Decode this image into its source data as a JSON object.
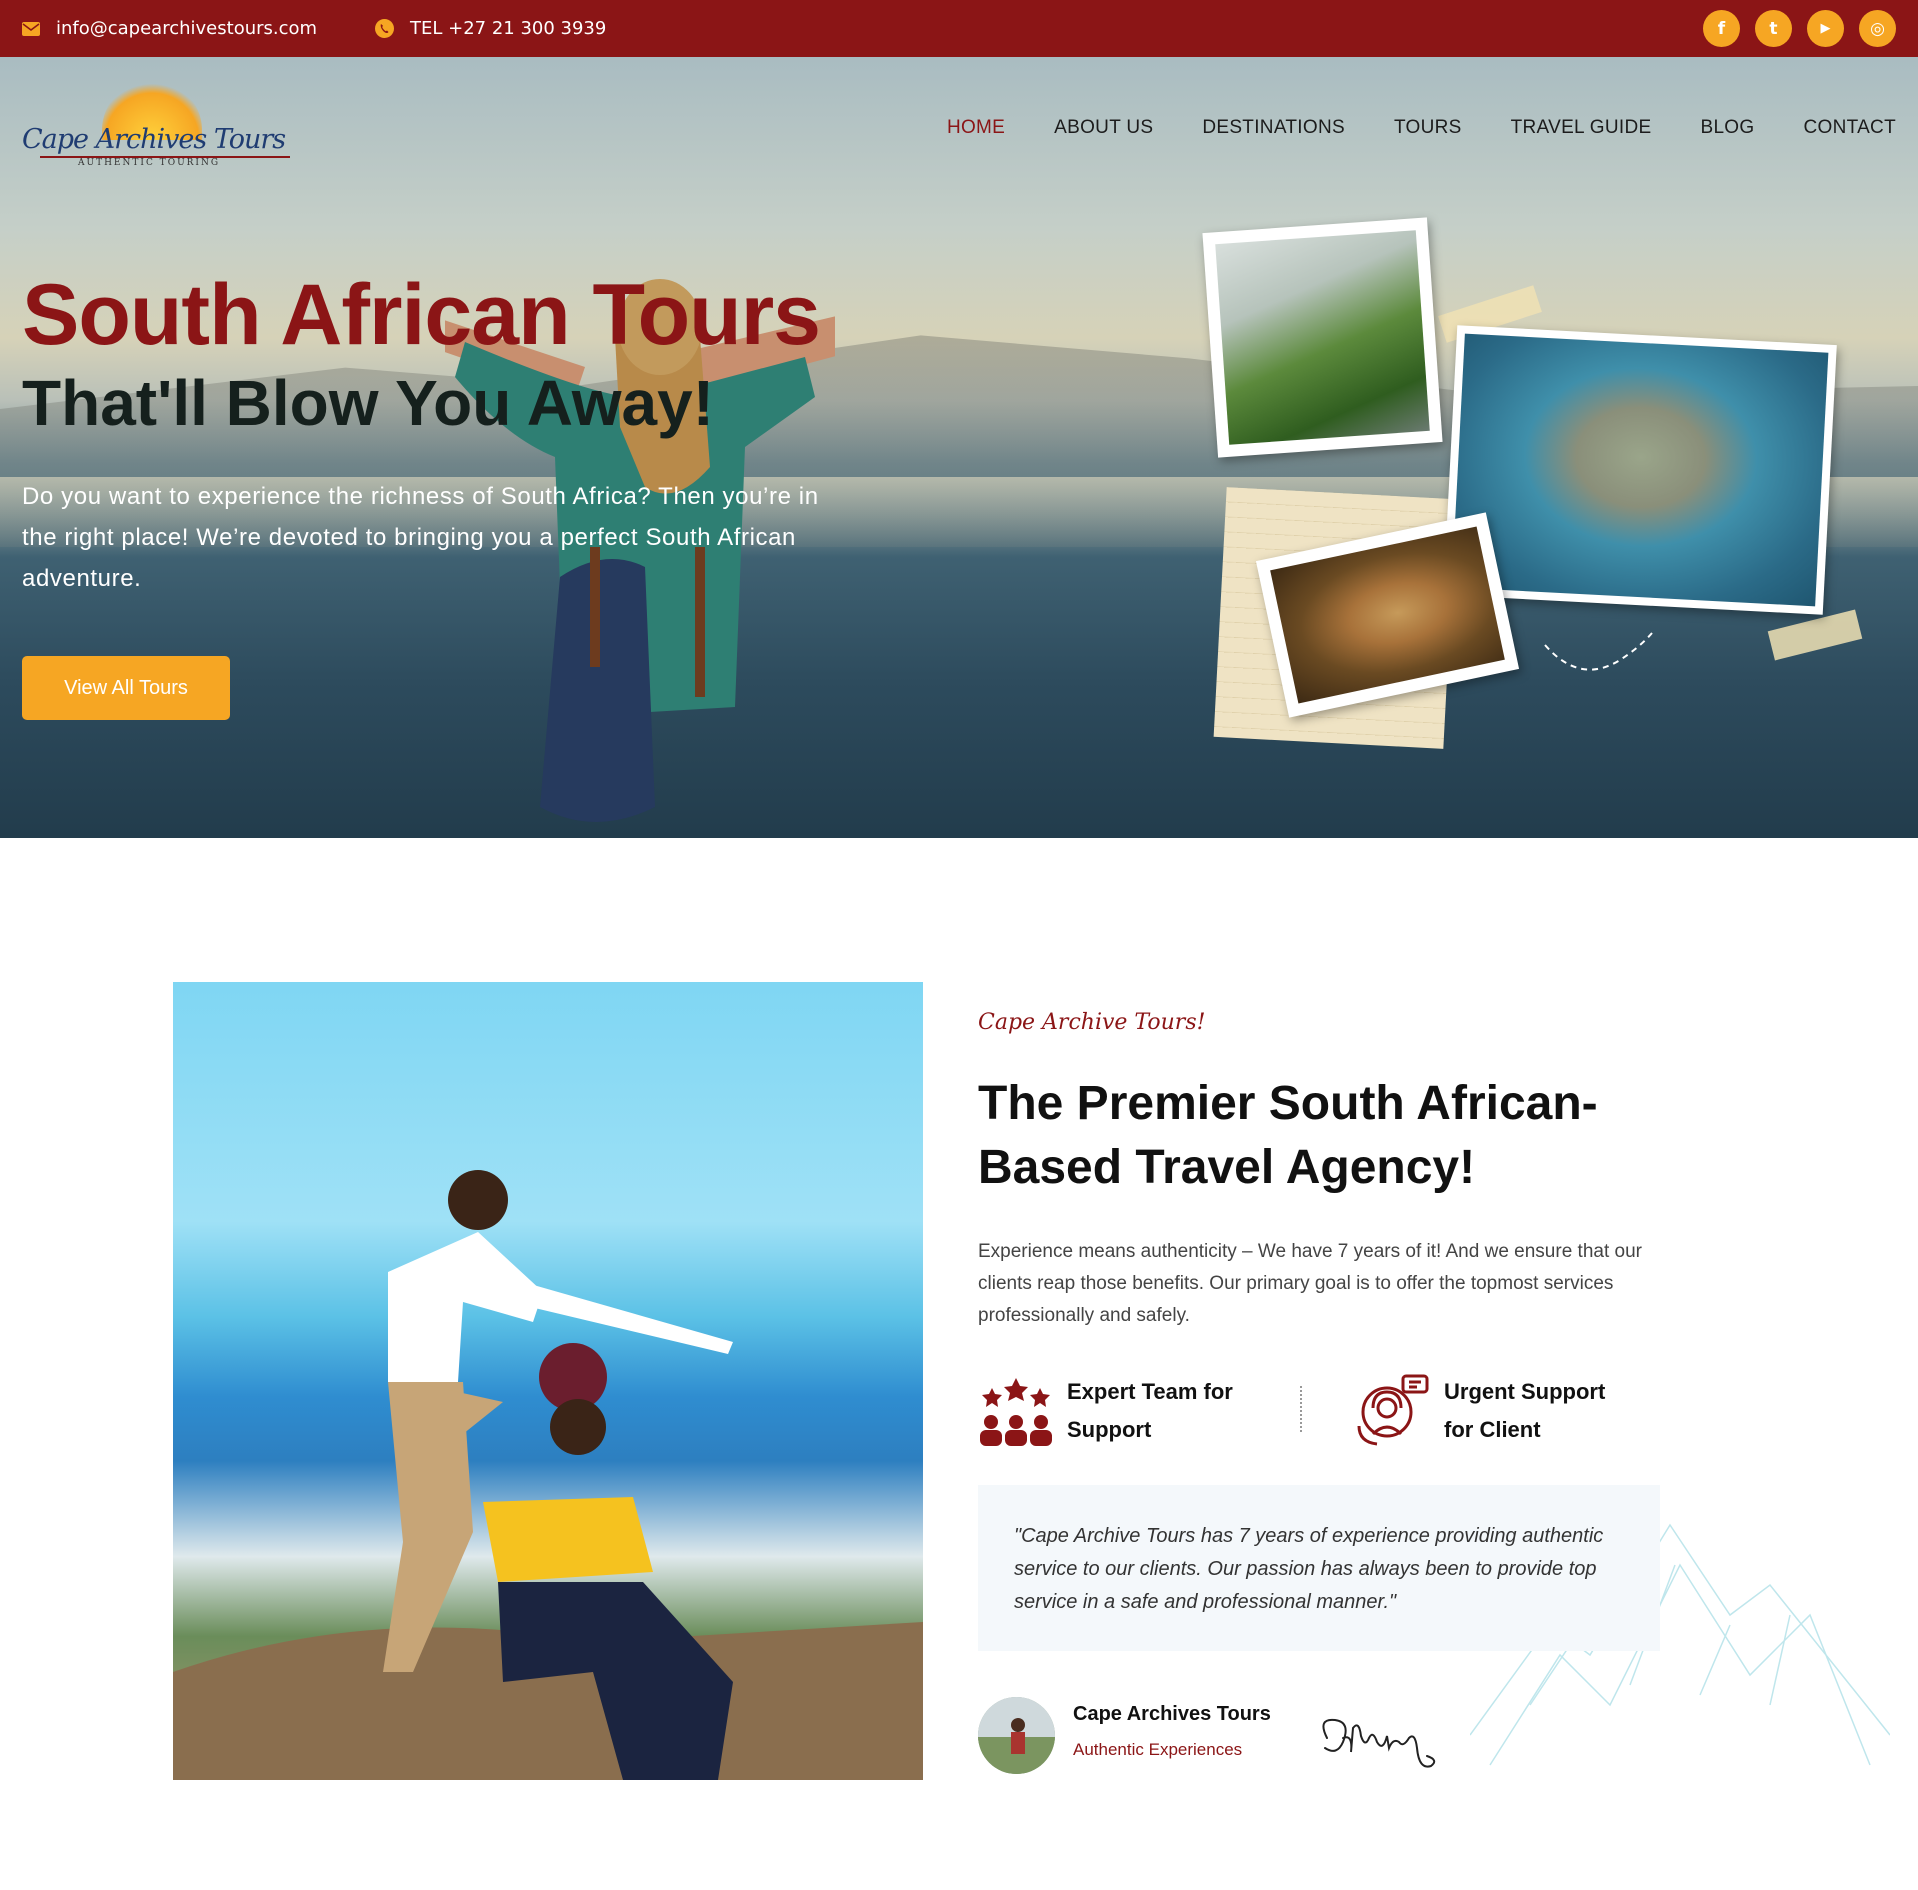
{
  "topbar": {
    "email": "info@capearchivestours.com",
    "phone": "TEL +27 21 300 3939",
    "socials": [
      {
        "icon": "facebook-icon",
        "glyph": "f"
      },
      {
        "icon": "twitter-icon",
        "glyph": "t"
      },
      {
        "icon": "youtube-icon",
        "glyph": "▶"
      },
      {
        "icon": "instagram-icon",
        "glyph": "◎"
      }
    ]
  },
  "logo": {
    "wordmark": "Cape Archives Tours",
    "tagline": "AUTHENTIC TOURING"
  },
  "nav": {
    "items": [
      "HOME",
      "ABOUT US",
      "DESTINATIONS",
      "TOURS",
      "TRAVEL GUIDE",
      "BLOG",
      "CONTACT"
    ],
    "active": "HOME"
  },
  "hero": {
    "title": "South African Tours",
    "subtitle": "That'll Blow You Away!",
    "text": "Do you want to experience the richness of South Africa? Then you’re in the right place! We’re devoted to bringing you a perfect South African adventure.",
    "button": "View All Tours"
  },
  "about": {
    "kicker": "Cape Archive Tours!",
    "title": "The Premier South African-Based Travel Agency!",
    "text": "Experience means authenticity – We have 7 years of it! And we ensure that our clients reap those benefits. Our primary goal is to offer the topmost services professionally and safely.",
    "features": [
      {
        "icon": "expert-team-icon",
        "label": "Expert Team for Support"
      },
      {
        "icon": "support-agent-icon",
        "label": "Urgent Support for Client"
      }
    ],
    "quote": "\"Cape Archive Tours has 7 years of experience providing authentic service to our clients. Our passion has always been to provide top service in a safe and professional manner.\"",
    "author": {
      "name": "Cape Archives Tours",
      "role": "Authentic Experiences"
    }
  },
  "colors": {
    "brand_red": "#8b1516",
    "accent_orange": "#f6a623",
    "quote_bg": "#f4f8fb"
  }
}
